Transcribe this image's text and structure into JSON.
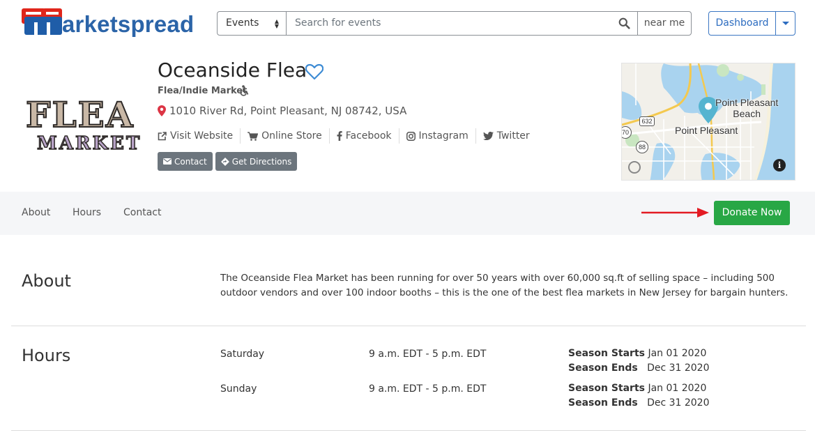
{
  "header": {
    "logo_text": "arketspread",
    "search_type": "Events",
    "search_placeholder": "Search for events",
    "near_me": "near me",
    "dashboard": "Dashboard"
  },
  "market": {
    "name": "Oceanside Flea",
    "category": "Flea/Indie Market",
    "address": "1010 River Rd, Point Pleasant, NJ 08742, USA",
    "logo_line1": "FLEA",
    "logo_line2": "MARKET",
    "links": [
      "Visit Website",
      "Online Store",
      "Facebook",
      "Instagram",
      "Twitter"
    ],
    "contact_button": "Contact",
    "directions_button": "Get Directions"
  },
  "map": {
    "label_beach": "Point Pleasant\nBeach",
    "label_town": "Point Pleasant",
    "shield_632": "632",
    "shield_70": "70",
    "shield_88": "88"
  },
  "subnav": {
    "about": "About",
    "hours": "Hours",
    "contact": "Contact",
    "donate": "Donate Now"
  },
  "about": {
    "heading": "About",
    "text": "The Oceanside Flea Market has been running for over 50 years with over 60,000 sq.ft of selling space – including 500 outdoor vendors and over 100 indoor booths – this is the one of the best flea markets in New Jersey for bargain hunters."
  },
  "hours": {
    "heading": "Hours",
    "rows": [
      {
        "day": "Saturday",
        "time": "9 a.m. EDT - 5 p.m. EDT",
        "season_starts_label": "Season Starts",
        "season_starts": "Jan 01 2020",
        "season_ends_label": "Season Ends",
        "season_ends": "Dec 31 2020"
      },
      {
        "day": "Sunday",
        "time": "9 a.m. EDT - 5 p.m. EDT",
        "season_starts_label": "Season Starts",
        "season_starts": "Jan 01 2020",
        "season_ends_label": "Season Ends",
        "season_ends": "Dec 31 2020"
      }
    ]
  },
  "colors": {
    "brand_blue": "#2b64a8",
    "brand_red": "#e0261b",
    "donate_green": "#28a745",
    "button_gray": "#6c757d",
    "pin_red": "#dc3545"
  }
}
